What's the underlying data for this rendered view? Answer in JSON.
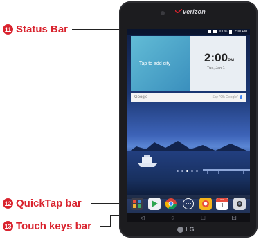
{
  "callouts": [
    {
      "number": "11",
      "label": "Status Bar"
    },
    {
      "number": "12",
      "label": "QuickTap bar"
    },
    {
      "number": "13",
      "label": "Touch keys bar"
    }
  ],
  "device": {
    "carrier": "verizon",
    "brand": "LG",
    "status_time": "2:00 PM",
    "status_battery": "100%",
    "weather_prompt": "Tap to add city",
    "clock_time": "2:00",
    "clock_ampm": "PM",
    "clock_date": "Tue, Jan 1",
    "search_brand": "Google",
    "search_hint": "Say \"Ok Google\"",
    "calendar_month": "TUE",
    "calendar_day": "1"
  },
  "colors": {
    "callout_red": "#d9232e",
    "tablet_body": "#1c1c1f"
  },
  "quicktap_apps": [
    "apps-folder-icon",
    "play-store-icon",
    "chrome-icon",
    "app-drawer-icon",
    "camera-icon",
    "calendar-icon",
    "photo-icon"
  ],
  "touch_keys": [
    {
      "icon": "back-key-icon",
      "glyph": "◁"
    },
    {
      "icon": "home-key-icon",
      "glyph": "○"
    },
    {
      "icon": "recents-key-icon",
      "glyph": "□"
    },
    {
      "icon": "dual-window-key-icon",
      "glyph": "⊟"
    }
  ]
}
